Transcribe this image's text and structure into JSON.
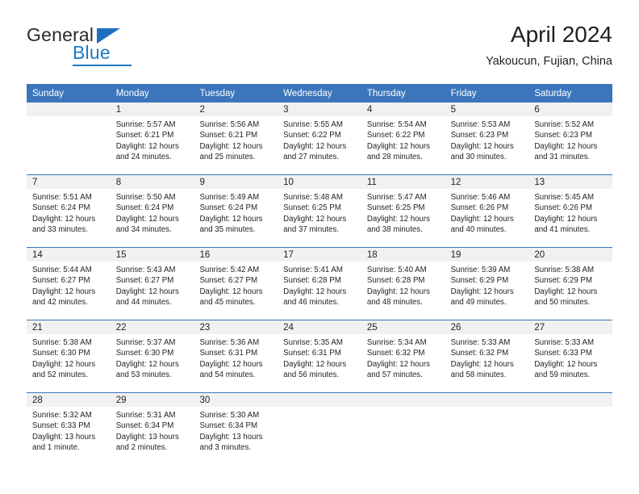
{
  "brand": {
    "name_part1": "General",
    "name_part2": "Blue"
  },
  "header": {
    "title": "April 2024",
    "location": "Yakoucun, Fujian, China"
  },
  "calendar": {
    "weekday_headers": [
      "Sunday",
      "Monday",
      "Tuesday",
      "Wednesday",
      "Thursday",
      "Friday",
      "Saturday"
    ],
    "accent_color": "#3b76bc",
    "day_band_color": "#f1f1f1",
    "labels": {
      "sunrise": "Sunrise:",
      "sunset": "Sunset:",
      "daylight": "Daylight:"
    },
    "weeks": [
      [
        {
          "day": "",
          "sunrise": "",
          "sunset": "",
          "daylight": "",
          "empty": true
        },
        {
          "day": "1",
          "sunrise": "Sunrise: 5:57 AM",
          "sunset": "Sunset: 6:21 PM",
          "daylight": "Daylight: 12 hours and 24 minutes."
        },
        {
          "day": "2",
          "sunrise": "Sunrise: 5:56 AM",
          "sunset": "Sunset: 6:21 PM",
          "daylight": "Daylight: 12 hours and 25 minutes."
        },
        {
          "day": "3",
          "sunrise": "Sunrise: 5:55 AM",
          "sunset": "Sunset: 6:22 PM",
          "daylight": "Daylight: 12 hours and 27 minutes."
        },
        {
          "day": "4",
          "sunrise": "Sunrise: 5:54 AM",
          "sunset": "Sunset: 6:22 PM",
          "daylight": "Daylight: 12 hours and 28 minutes."
        },
        {
          "day": "5",
          "sunrise": "Sunrise: 5:53 AM",
          "sunset": "Sunset: 6:23 PM",
          "daylight": "Daylight: 12 hours and 30 minutes."
        },
        {
          "day": "6",
          "sunrise": "Sunrise: 5:52 AM",
          "sunset": "Sunset: 6:23 PM",
          "daylight": "Daylight: 12 hours and 31 minutes."
        }
      ],
      [
        {
          "day": "7",
          "sunrise": "Sunrise: 5:51 AM",
          "sunset": "Sunset: 6:24 PM",
          "daylight": "Daylight: 12 hours and 33 minutes."
        },
        {
          "day": "8",
          "sunrise": "Sunrise: 5:50 AM",
          "sunset": "Sunset: 6:24 PM",
          "daylight": "Daylight: 12 hours and 34 minutes."
        },
        {
          "day": "9",
          "sunrise": "Sunrise: 5:49 AM",
          "sunset": "Sunset: 6:24 PM",
          "daylight": "Daylight: 12 hours and 35 minutes."
        },
        {
          "day": "10",
          "sunrise": "Sunrise: 5:48 AM",
          "sunset": "Sunset: 6:25 PM",
          "daylight": "Daylight: 12 hours and 37 minutes."
        },
        {
          "day": "11",
          "sunrise": "Sunrise: 5:47 AM",
          "sunset": "Sunset: 6:25 PM",
          "daylight": "Daylight: 12 hours and 38 minutes."
        },
        {
          "day": "12",
          "sunrise": "Sunrise: 5:46 AM",
          "sunset": "Sunset: 6:26 PM",
          "daylight": "Daylight: 12 hours and 40 minutes."
        },
        {
          "day": "13",
          "sunrise": "Sunrise: 5:45 AM",
          "sunset": "Sunset: 6:26 PM",
          "daylight": "Daylight: 12 hours and 41 minutes."
        }
      ],
      [
        {
          "day": "14",
          "sunrise": "Sunrise: 5:44 AM",
          "sunset": "Sunset: 6:27 PM",
          "daylight": "Daylight: 12 hours and 42 minutes."
        },
        {
          "day": "15",
          "sunrise": "Sunrise: 5:43 AM",
          "sunset": "Sunset: 6:27 PM",
          "daylight": "Daylight: 12 hours and 44 minutes."
        },
        {
          "day": "16",
          "sunrise": "Sunrise: 5:42 AM",
          "sunset": "Sunset: 6:27 PM",
          "daylight": "Daylight: 12 hours and 45 minutes."
        },
        {
          "day": "17",
          "sunrise": "Sunrise: 5:41 AM",
          "sunset": "Sunset: 6:28 PM",
          "daylight": "Daylight: 12 hours and 46 minutes."
        },
        {
          "day": "18",
          "sunrise": "Sunrise: 5:40 AM",
          "sunset": "Sunset: 6:28 PM",
          "daylight": "Daylight: 12 hours and 48 minutes."
        },
        {
          "day": "19",
          "sunrise": "Sunrise: 5:39 AM",
          "sunset": "Sunset: 6:29 PM",
          "daylight": "Daylight: 12 hours and 49 minutes."
        },
        {
          "day": "20",
          "sunrise": "Sunrise: 5:38 AM",
          "sunset": "Sunset: 6:29 PM",
          "daylight": "Daylight: 12 hours and 50 minutes."
        }
      ],
      [
        {
          "day": "21",
          "sunrise": "Sunrise: 5:38 AM",
          "sunset": "Sunset: 6:30 PM",
          "daylight": "Daylight: 12 hours and 52 minutes."
        },
        {
          "day": "22",
          "sunrise": "Sunrise: 5:37 AM",
          "sunset": "Sunset: 6:30 PM",
          "daylight": "Daylight: 12 hours and 53 minutes."
        },
        {
          "day": "23",
          "sunrise": "Sunrise: 5:36 AM",
          "sunset": "Sunset: 6:31 PM",
          "daylight": "Daylight: 12 hours and 54 minutes."
        },
        {
          "day": "24",
          "sunrise": "Sunrise: 5:35 AM",
          "sunset": "Sunset: 6:31 PM",
          "daylight": "Daylight: 12 hours and 56 minutes."
        },
        {
          "day": "25",
          "sunrise": "Sunrise: 5:34 AM",
          "sunset": "Sunset: 6:32 PM",
          "daylight": "Daylight: 12 hours and 57 minutes."
        },
        {
          "day": "26",
          "sunrise": "Sunrise: 5:33 AM",
          "sunset": "Sunset: 6:32 PM",
          "daylight": "Daylight: 12 hours and 58 minutes."
        },
        {
          "day": "27",
          "sunrise": "Sunrise: 5:33 AM",
          "sunset": "Sunset: 6:33 PM",
          "daylight": "Daylight: 12 hours and 59 minutes."
        }
      ],
      [
        {
          "day": "28",
          "sunrise": "Sunrise: 5:32 AM",
          "sunset": "Sunset: 6:33 PM",
          "daylight": "Daylight: 13 hours and 1 minute."
        },
        {
          "day": "29",
          "sunrise": "Sunrise: 5:31 AM",
          "sunset": "Sunset: 6:34 PM",
          "daylight": "Daylight: 13 hours and 2 minutes."
        },
        {
          "day": "30",
          "sunrise": "Sunrise: 5:30 AM",
          "sunset": "Sunset: 6:34 PM",
          "daylight": "Daylight: 13 hours and 3 minutes."
        },
        {
          "day": "",
          "sunrise": "",
          "sunset": "",
          "daylight": "",
          "empty": true
        },
        {
          "day": "",
          "sunrise": "",
          "sunset": "",
          "daylight": "",
          "empty": true
        },
        {
          "day": "",
          "sunrise": "",
          "sunset": "",
          "daylight": "",
          "empty": true
        },
        {
          "day": "",
          "sunrise": "",
          "sunset": "",
          "daylight": "",
          "empty": true
        }
      ]
    ]
  }
}
